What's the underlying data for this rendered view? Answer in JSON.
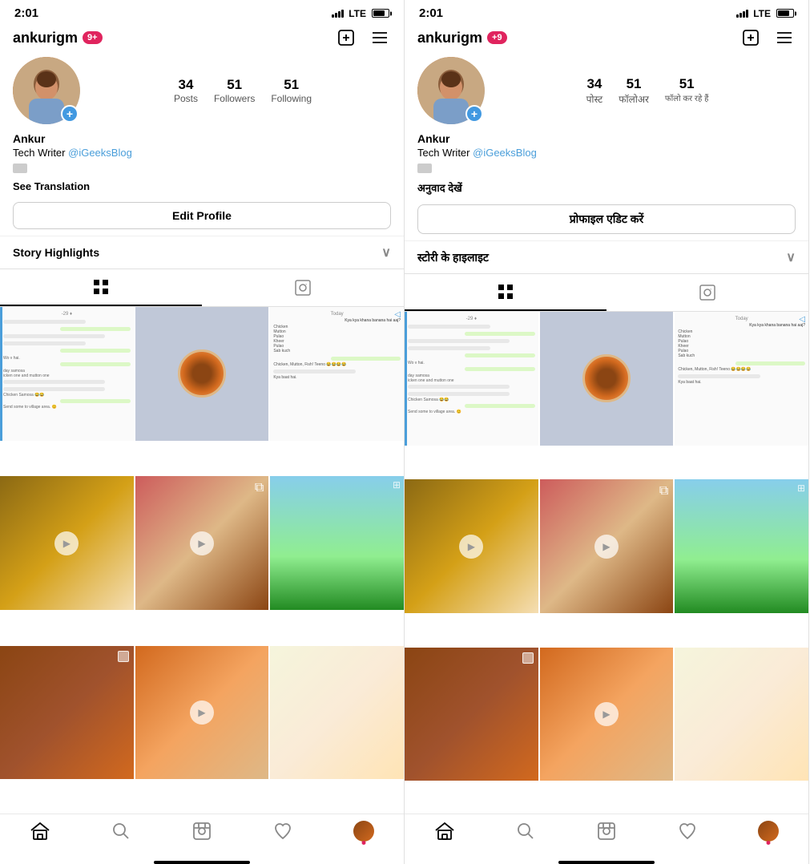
{
  "left_phone": {
    "status": {
      "time": "2:01",
      "lte": "LTE"
    },
    "header": {
      "username": "ankurigm",
      "notification": "9+",
      "add_icon": "⊕",
      "menu_icon": "≡"
    },
    "stats": {
      "posts_count": "34",
      "posts_label": "Posts",
      "followers_count": "51",
      "followers_label": "Followers",
      "following_count": "51",
      "following_label": "Following"
    },
    "bio": {
      "name": "Ankur",
      "occupation": "Tech Writer",
      "handle": "@iGeeksBlog"
    },
    "see_translation": "See Translation",
    "edit_profile": "Edit Profile",
    "story_highlights": "Story Highlights",
    "nav": {
      "home": "⌂",
      "search": "🔍",
      "reels": "▶",
      "heart": "♡",
      "profile": ""
    }
  },
  "right_phone": {
    "status": {
      "time": "2:01",
      "lte": "LTE"
    },
    "header": {
      "username": "ankurigm",
      "notification": "+9",
      "add_icon": "⊕",
      "menu_icon": "≡"
    },
    "stats": {
      "posts_count": "34",
      "posts_label": "पोस्ट",
      "followers_count": "51",
      "followers_label": "फॉलोअर",
      "following_count": "51",
      "following_label": "फॉलो कर रहे हैं"
    },
    "bio": {
      "name": "Ankur",
      "occupation": "Tech Writer",
      "handle": "@iGeeksBlog"
    },
    "see_translation": "अनुवाद देखें",
    "edit_profile": "प्रोफाइल एडिट करें",
    "story_highlights": "स्टोरी के हाइलाइट",
    "nav": {
      "home": "⌂",
      "search": "🔍",
      "reels": "▶",
      "heart": "♡",
      "profile": ""
    }
  },
  "colors": {
    "accent_blue": "#4a9eda",
    "notification_red": "#e0245e",
    "add_btn_blue": "#4299e1",
    "border": "#e0e0e0",
    "text_dark": "#000000",
    "text_gray": "#555555"
  }
}
